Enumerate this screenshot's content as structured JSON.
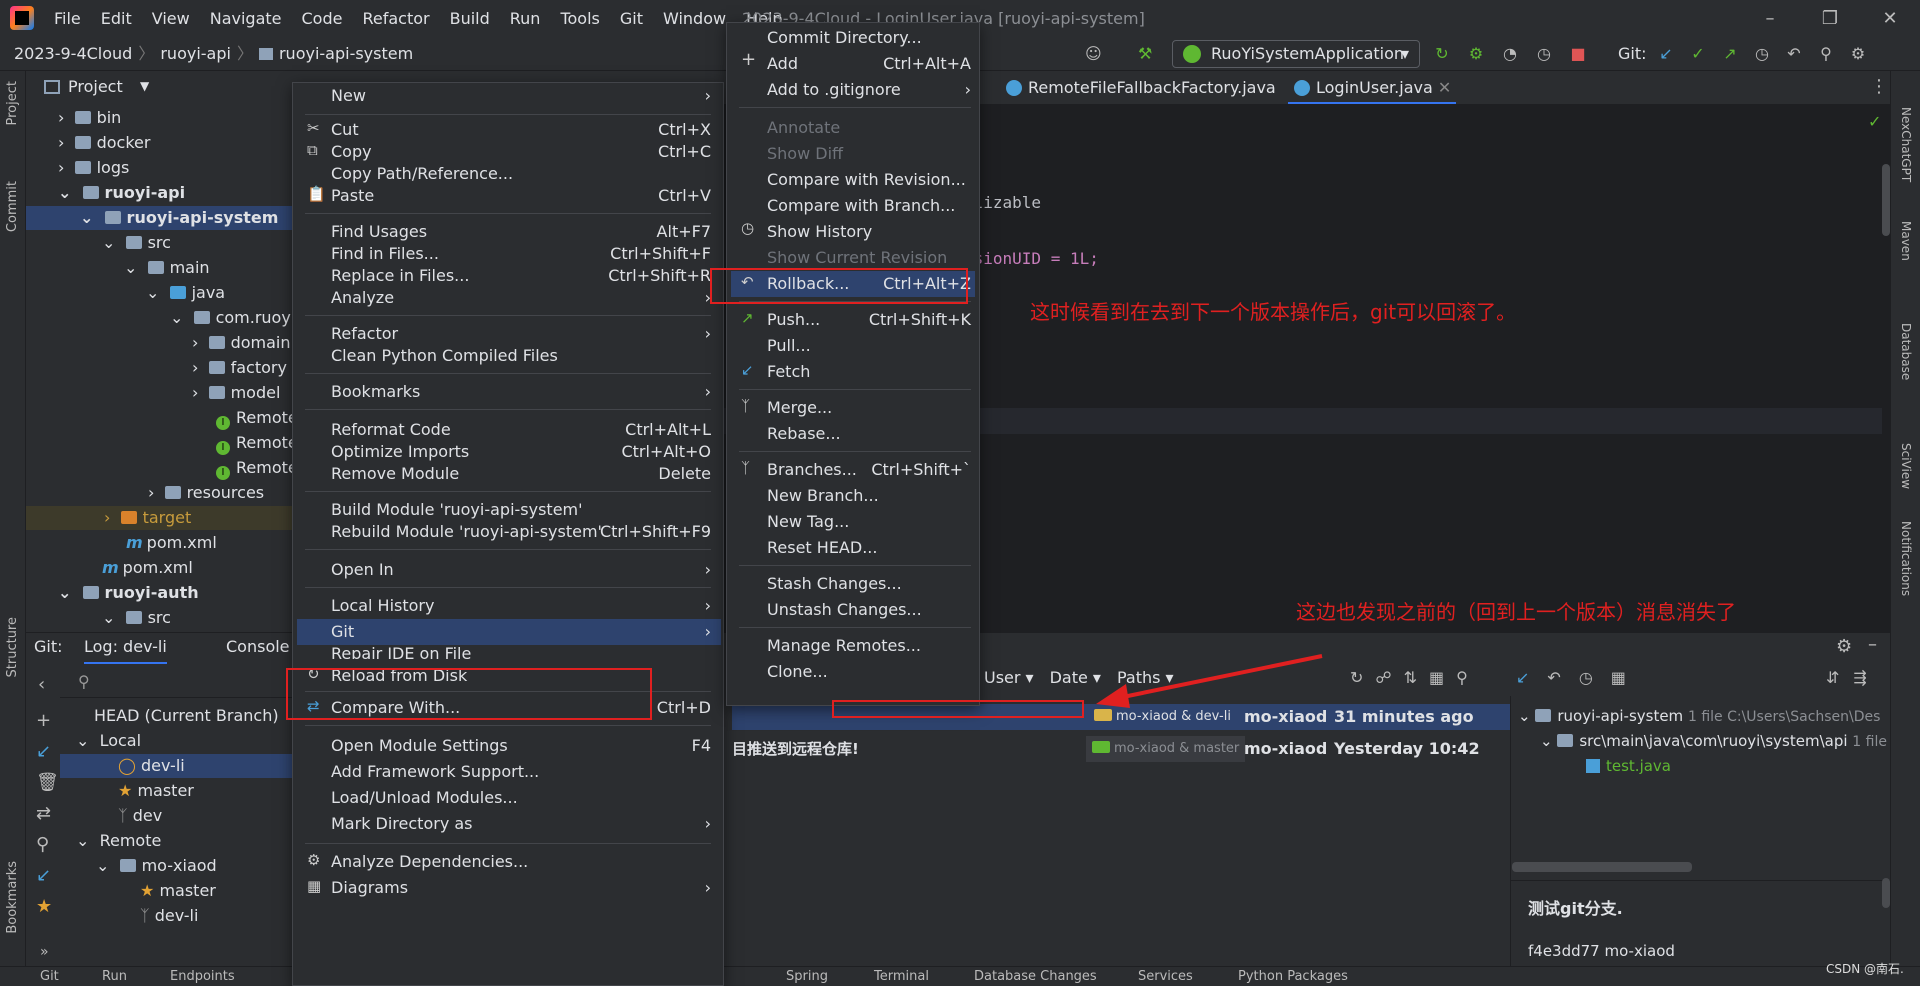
{
  "app": {
    "window_title": "2023-9-4Cloud - LoginUser.java [ruoyi-api-system]",
    "menu": [
      "File",
      "Edit",
      "View",
      "Navigate",
      "Code",
      "Refactor",
      "Build",
      "Run",
      "Tools",
      "Git",
      "Window",
      "Help"
    ],
    "breadcrumbs": [
      "2023-9-4Cloud",
      "ruoyi-api",
      "ruoyi-api-system"
    ],
    "run_config": "RuoYiSystemApplication",
    "git_label": "Git:"
  },
  "project": {
    "header": "Project",
    "tree": [
      {
        "label": "bin"
      },
      {
        "label": "docker"
      },
      {
        "label": "logs"
      },
      {
        "label": "ruoyi-api"
      },
      {
        "label": "ruoyi-api-system"
      },
      {
        "label": "src"
      },
      {
        "label": "main"
      },
      {
        "label": "java"
      },
      {
        "label": "com.ruoyi"
      },
      {
        "label": "domain"
      },
      {
        "label": "factory"
      },
      {
        "label": "model"
      },
      {
        "label": "Remote"
      },
      {
        "label": "Remote"
      },
      {
        "label": "Remote"
      },
      {
        "label": "resources"
      },
      {
        "label": "target"
      },
      {
        "label": "pom.xml"
      },
      {
        "label": "pom.xml"
      },
      {
        "label": "ruoyi-auth"
      },
      {
        "label": "src"
      }
    ]
  },
  "editor": {
    "tabs": [
      "RemoteFileFallbackFactory.java",
      "LoginUser.java"
    ],
    "code": [
      "alizable",
      "rsionUID = 1L;"
    ]
  },
  "left_strip": [
    "Project",
    "Commit",
    "Structure",
    "Bookmarks"
  ],
  "right_strip": [
    "NexChatGPT",
    "Maven",
    "Database",
    "SciView",
    "Notifications"
  ],
  "context_menu": {
    "items": [
      {
        "label": "New",
        "shortcut": "",
        "sub": true
      },
      {
        "label": "Cut",
        "shortcut": "Ctrl+X"
      },
      {
        "label": "Copy",
        "shortcut": "Ctrl+C"
      },
      {
        "label": "Copy Path/Reference...",
        "shortcut": ""
      },
      {
        "label": "Paste",
        "shortcut": "Ctrl+V"
      },
      {
        "label": "Find Usages",
        "shortcut": "Alt+F7"
      },
      {
        "label": "Find in Files...",
        "shortcut": "Ctrl+Shift+F"
      },
      {
        "label": "Replace in Files...",
        "shortcut": "Ctrl+Shift+R"
      },
      {
        "label": "Analyze",
        "shortcut": "",
        "sub": true
      },
      {
        "label": "Refactor",
        "shortcut": "",
        "sub": true
      },
      {
        "label": "Clean Python Compiled Files",
        "shortcut": ""
      },
      {
        "label": "Bookmarks",
        "shortcut": "",
        "sub": true
      },
      {
        "label": "Reformat Code",
        "shortcut": "Ctrl+Alt+L"
      },
      {
        "label": "Optimize Imports",
        "shortcut": "Ctrl+Alt+O"
      },
      {
        "label": "Remove Module",
        "shortcut": "Delete"
      },
      {
        "label": "Build Module 'ruoyi-api-system'",
        "shortcut": ""
      },
      {
        "label": "Rebuild Module 'ruoyi-api-system'",
        "shortcut": "Ctrl+Shift+F9"
      },
      {
        "label": "Open In",
        "shortcut": "",
        "sub": true
      },
      {
        "label": "Local History",
        "shortcut": "",
        "sub": true
      },
      {
        "label": "Git",
        "shortcut": "",
        "sub": true
      },
      {
        "label": "Repair IDE on File",
        "shortcut": ""
      },
      {
        "label": "Reload from Disk",
        "shortcut": ""
      },
      {
        "label": "Compare With...",
        "shortcut": "Ctrl+D"
      },
      {
        "label": "Open Module Settings",
        "shortcut": "F4"
      },
      {
        "label": "Add Framework Support...",
        "shortcut": ""
      },
      {
        "label": "Load/Unload Modules...",
        "shortcut": ""
      },
      {
        "label": "Mark Directory as",
        "shortcut": "",
        "sub": true
      },
      {
        "label": "Analyze Dependencies...",
        "shortcut": ""
      },
      {
        "label": "Diagrams",
        "shortcut": "",
        "sub": true
      }
    ]
  },
  "git_menu": {
    "items": [
      {
        "label": "Commit Directory...",
        "shortcut": ""
      },
      {
        "label": "Add",
        "shortcut": "Ctrl+Alt+A"
      },
      {
        "label": "Add to .gitignore",
        "shortcut": "",
        "sub": true
      },
      {
        "label": "Annotate",
        "shortcut": "",
        "disabled": true
      },
      {
        "label": "Show Diff",
        "shortcut": "",
        "disabled": true
      },
      {
        "label": "Compare with Revision...",
        "shortcut": ""
      },
      {
        "label": "Compare with Branch...",
        "shortcut": ""
      },
      {
        "label": "Show History",
        "shortcut": ""
      },
      {
        "label": "Show Current Revision",
        "shortcut": "",
        "disabled": true
      },
      {
        "label": "Rollback...",
        "shortcut": "Ctrl+Alt+Z"
      },
      {
        "label": "Push...",
        "shortcut": "Ctrl+Shift+K"
      },
      {
        "label": "Pull...",
        "shortcut": ""
      },
      {
        "label": "Fetch",
        "shortcut": ""
      },
      {
        "label": "Merge...",
        "shortcut": ""
      },
      {
        "label": "Rebase...",
        "shortcut": ""
      },
      {
        "label": "Branches...",
        "shortcut": "Ctrl+Shift+`"
      },
      {
        "label": "New Branch...",
        "shortcut": ""
      },
      {
        "label": "New Tag...",
        "shortcut": ""
      },
      {
        "label": "Reset HEAD...",
        "shortcut": ""
      },
      {
        "label": "Stash Changes...",
        "shortcut": ""
      },
      {
        "label": "Unstash Changes...",
        "shortcut": ""
      },
      {
        "label": "Manage Remotes...",
        "shortcut": ""
      },
      {
        "label": "Clone...",
        "shortcut": ""
      }
    ]
  },
  "annotations": {
    "a1": "这时候看到在去到下一个版本操作后，git可以回滚了。",
    "a2": "这边也发现之前的（回到上一个版本）消息消失了"
  },
  "git_panel": {
    "tabs": [
      "Git:",
      "Log: dev-li",
      "Console"
    ],
    "branches": {
      "head": "HEAD (Current Branch)",
      "local": "Local",
      "local_items": [
        "dev-li",
        "master",
        "dev"
      ],
      "remote": "Remote",
      "remote_group": "mo-xiaod",
      "remote_items": [
        "master",
        "dev-li"
      ]
    },
    "filters": [
      "User",
      "Date",
      "Paths"
    ],
    "rows": [
      {
        "msg": "",
        "refs": "mo-xiaod & dev-li",
        "author": "mo-xiaod",
        "date": "31 minutes ago"
      },
      {
        "msg": "目推送到远程仓库!",
        "refs": "mo-xiaod & master",
        "author": "mo-xiaod",
        "date": "Yesterday 10:42"
      }
    ],
    "detail": {
      "root": "ruoyi-api-system",
      "root_meta": "1 file  C:\\Users\\Sachsen\\Des",
      "dir": "src\\main\\java\\com\\ruoyi\\system\\api",
      "dir_meta": "1 file",
      "file": "test.java",
      "message": "测试git分支.",
      "hash": "f4e3dd77 mo-xiaod"
    }
  },
  "status_bar": {
    "items": [
      "Git",
      "Run",
      "Endpoints",
      "Spring",
      "Terminal",
      "Database Changes",
      "Services",
      "Python Packages"
    ],
    "watermark": "CSDN @南石."
  }
}
